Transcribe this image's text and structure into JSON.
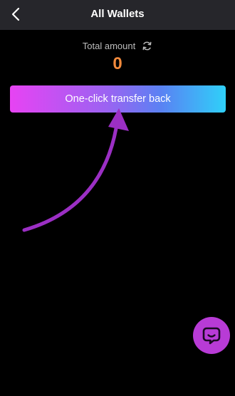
{
  "header": {
    "title": "All Wallets",
    "back_icon": "chevron-left-icon"
  },
  "summary": {
    "label": "Total amount",
    "value": "0",
    "refresh_icon": "refresh-icon"
  },
  "actions": {
    "transfer_back_label": "One-click transfer back"
  },
  "support": {
    "chat_icon": "chat-bubble-icon"
  },
  "colors": {
    "header_bg": "#26262b",
    "page_bg": "#000000",
    "amount": "#f28a3c",
    "gradient_start": "#e743f3",
    "gradient_end": "#2fd0f9",
    "annotation_arrow": "#9b2fc4",
    "chat_button": "#b83bd6"
  }
}
